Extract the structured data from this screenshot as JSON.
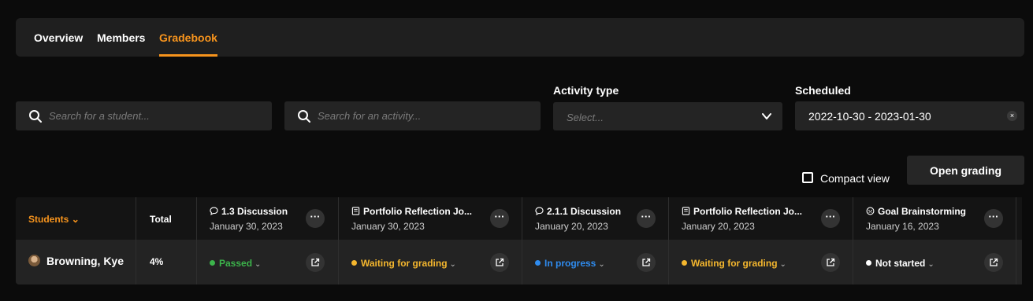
{
  "tabs": [
    {
      "label": "Overview"
    },
    {
      "label": "Members"
    },
    {
      "label": "Gradebook"
    }
  ],
  "filters": {
    "student_search_placeholder": "Search for a student...",
    "activity_search_placeholder": "Search for an activity...",
    "activity_type_label": "Activity type",
    "activity_type_placeholder": "Select...",
    "scheduled_label": "Scheduled",
    "scheduled_value": "2022-10-30 - 2023-01-30",
    "clear_icon": "×"
  },
  "actions": {
    "compact_view_label": "Compact view",
    "open_grading_label": "Open grading"
  },
  "grid": {
    "students_header": "Students",
    "total_header": "Total",
    "activities": [
      {
        "title": "1.3 Discussion",
        "date": "January 30, 2023",
        "icon": "chat-icon"
      },
      {
        "title": "Portfolio Reflection Jo...",
        "date": "January 30, 2023",
        "icon": "book-icon"
      },
      {
        "title": "2.1.1 Discussion",
        "date": "January 20, 2023",
        "icon": "chat-icon"
      },
      {
        "title": "Portfolio Reflection Jo...",
        "date": "January 20, 2023",
        "icon": "book-icon"
      },
      {
        "title": "Goal Brainstorming",
        "date": "January 16, 2023",
        "icon": "goal-icon"
      }
    ],
    "rows": [
      {
        "student": "Browning, Kye",
        "total": "4%",
        "statuses": [
          {
            "label": "Passed",
            "color": "#3cb44b"
          },
          {
            "label": "Waiting for grading",
            "color": "#f5b72e"
          },
          {
            "label": "In progress",
            "color": "#2f8cf0"
          },
          {
            "label": "Waiting for grading",
            "color": "#f5b72e"
          },
          {
            "label": "Not started",
            "color": "#ffffff"
          }
        ]
      }
    ]
  },
  "colors": {
    "accent": "#f7941d"
  }
}
